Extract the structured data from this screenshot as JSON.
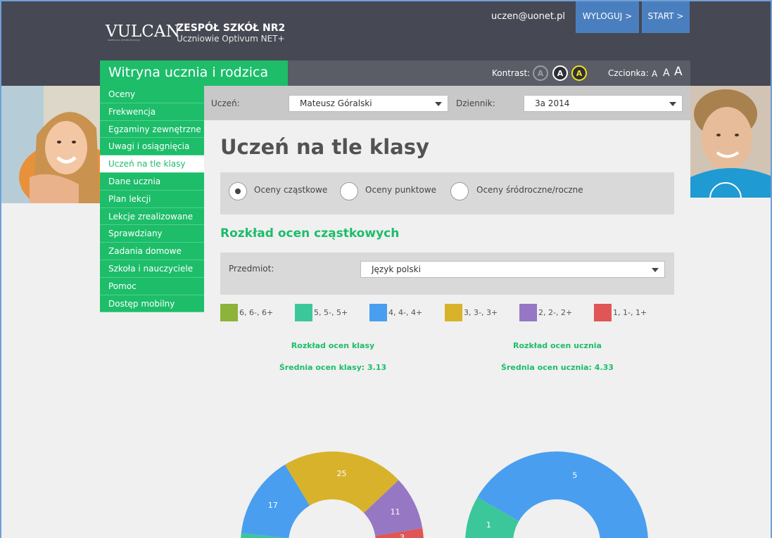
{
  "header": {
    "logo": "VULCAN",
    "logo_tagline": "RAZEM DLA LEPSZEJ EDUKACJI",
    "school_name": "ZESPÓŁ SZKÓŁ NR2",
    "school_sub": "Uczniowie Optivum NET+",
    "user_email": "uczen@uonet.pl",
    "logout_label": "WYLOGUJ >",
    "start_label": "START >"
  },
  "site_title": "Witryna ucznia i rodzica",
  "accessibility": {
    "contrast_label": "Kontrast:",
    "contrast_options": [
      "A",
      "A",
      "A"
    ],
    "font_label": "Czcionka:",
    "font_options": [
      "A",
      "A",
      "A"
    ]
  },
  "sidebar": {
    "items": [
      {
        "label": "Oceny"
      },
      {
        "label": "Frekwencja"
      },
      {
        "label": "Egzaminy zewnętrzne"
      },
      {
        "label": "Uwagi i osiągnięcia"
      },
      {
        "label": "Uczeń na tle klasy",
        "active": true
      },
      {
        "label": "Dane ucznia"
      },
      {
        "label": "Plan lekcji"
      },
      {
        "label": "Lekcje zrealizowane"
      },
      {
        "label": "Sprawdziany"
      },
      {
        "label": "Zadania domowe"
      },
      {
        "label": "Szkoła i nauczyciele"
      },
      {
        "label": "Pomoc"
      },
      {
        "label": "Dostęp mobilny"
      }
    ]
  },
  "filters": {
    "student_label": "Uczeń:",
    "student_value": "Mateusz Góralski",
    "journal_label": "Dziennik:",
    "journal_value": "3a 2014"
  },
  "page_title": "Uczeń na tle klasy",
  "grade_type": {
    "options": [
      "Oceny cząstkowe",
      "Oceny punktowe",
      "Oceny śródroczne/roczne"
    ],
    "selected": "Oceny cząstkowe"
  },
  "section_title": "Rozkład ocen cząstkowych",
  "subject": {
    "label": "Przedmiot:",
    "value": "Język polski"
  },
  "legend": [
    {
      "label": "6, 6-, 6+",
      "color": "#8db33a"
    },
    {
      "label": "5, 5-, 5+",
      "color": "#3cc79a"
    },
    {
      "label": "4, 4-, 4+",
      "color": "#4a9eef"
    },
    {
      "label": "3, 3-, 3+",
      "color": "#d8b22a"
    },
    {
      "label": "2, 2-, 2+",
      "color": "#9677c4"
    },
    {
      "label": "1, 1-, 1+",
      "color": "#e05555"
    }
  ],
  "class_chart": {
    "title": "Rozkład ocen klasy",
    "average": "Średnia ocen klasy: 3.13"
  },
  "student_chart": {
    "title": "Rozkład ocen ucznia",
    "average": "Średnia ocen ucznia: 4.33"
  },
  "chart_data": [
    {
      "type": "pie",
      "title": "Rozkład ocen klasy",
      "categories": [
        "6, 6-, 6+",
        "5, 5-, 5+",
        "4, 4-, 4+",
        "3, 3-, 3+",
        "2, 2-, 2+",
        "1, 1-, 1+"
      ],
      "values": [
        0,
        2,
        17,
        25,
        11,
        3
      ],
      "labels": [
        "",
        "",
        "17",
        "25",
        "11",
        "3"
      ]
    },
    {
      "type": "pie",
      "title": "Rozkład ocen ucznia",
      "categories": [
        "6, 6-, 6+",
        "5, 5-, 5+",
        "4, 4-, 4+",
        "3, 3-, 3+",
        "2, 2-, 2+",
        "1, 1-, 1+"
      ],
      "values": [
        0,
        1,
        5,
        0,
        0,
        0
      ],
      "labels": [
        "",
        "1",
        "5",
        "",
        "",
        ""
      ]
    }
  ]
}
